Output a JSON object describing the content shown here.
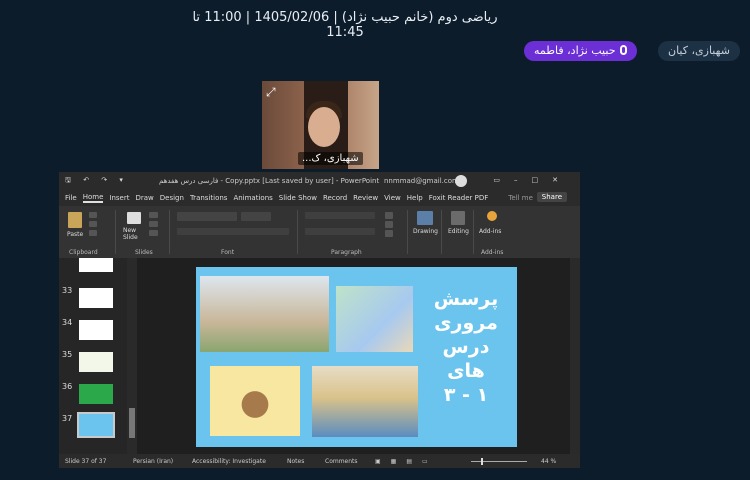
{
  "meeting": {
    "title": "ریاضی دوم (خانم حبیب نژاد) | 1405/02/06 | 11:00 تا 11:45",
    "participants": [
      {
        "name": "حبیب نژاد، فاطمه",
        "speaking": true
      },
      {
        "name": "شهبازی، کیان",
        "speaking": false
      }
    ],
    "camera_label": "شهبازی، ک..."
  },
  "powerpoint": {
    "doc_title": "فارسی درس هفدهم - Copy.pptx [Last saved by user] - PowerPoint",
    "account": "nnmmad@gmail.com",
    "menu": [
      "File",
      "Home",
      "Insert",
      "Draw",
      "Design",
      "Transitions",
      "Animations",
      "Slide Show",
      "Record",
      "Review",
      "View",
      "Help",
      "Foxit Reader PDF"
    ],
    "tell_me": "Tell me",
    "share": "Share",
    "ribbon": {
      "paste": "Paste",
      "new_slide": "New Slide",
      "drawing": "Drawing",
      "editing": "Editing",
      "addins": "Add-ins",
      "groups": [
        "Clipboard",
        "Slides",
        "Font",
        "Paragraph",
        "Add-ins"
      ]
    },
    "thumbnails": [
      "33",
      "34",
      "35",
      "36",
      "37"
    ],
    "slide_text": {
      "line1": "پرسش",
      "line2": "مروری",
      "line3": "درس های",
      "line4": "۱ - ۳"
    },
    "status": {
      "slide": "Slide 37 of 37",
      "language": "Persian (Iran)",
      "accessibility": "Accessibility: Investigate",
      "notes": "Notes",
      "comments": "Comments",
      "zoom": "44 %"
    }
  },
  "colors": {
    "background": "#0c1c2b",
    "speaker_chip": "#6c2fd6",
    "slide_bg": "#6bc4ed"
  }
}
